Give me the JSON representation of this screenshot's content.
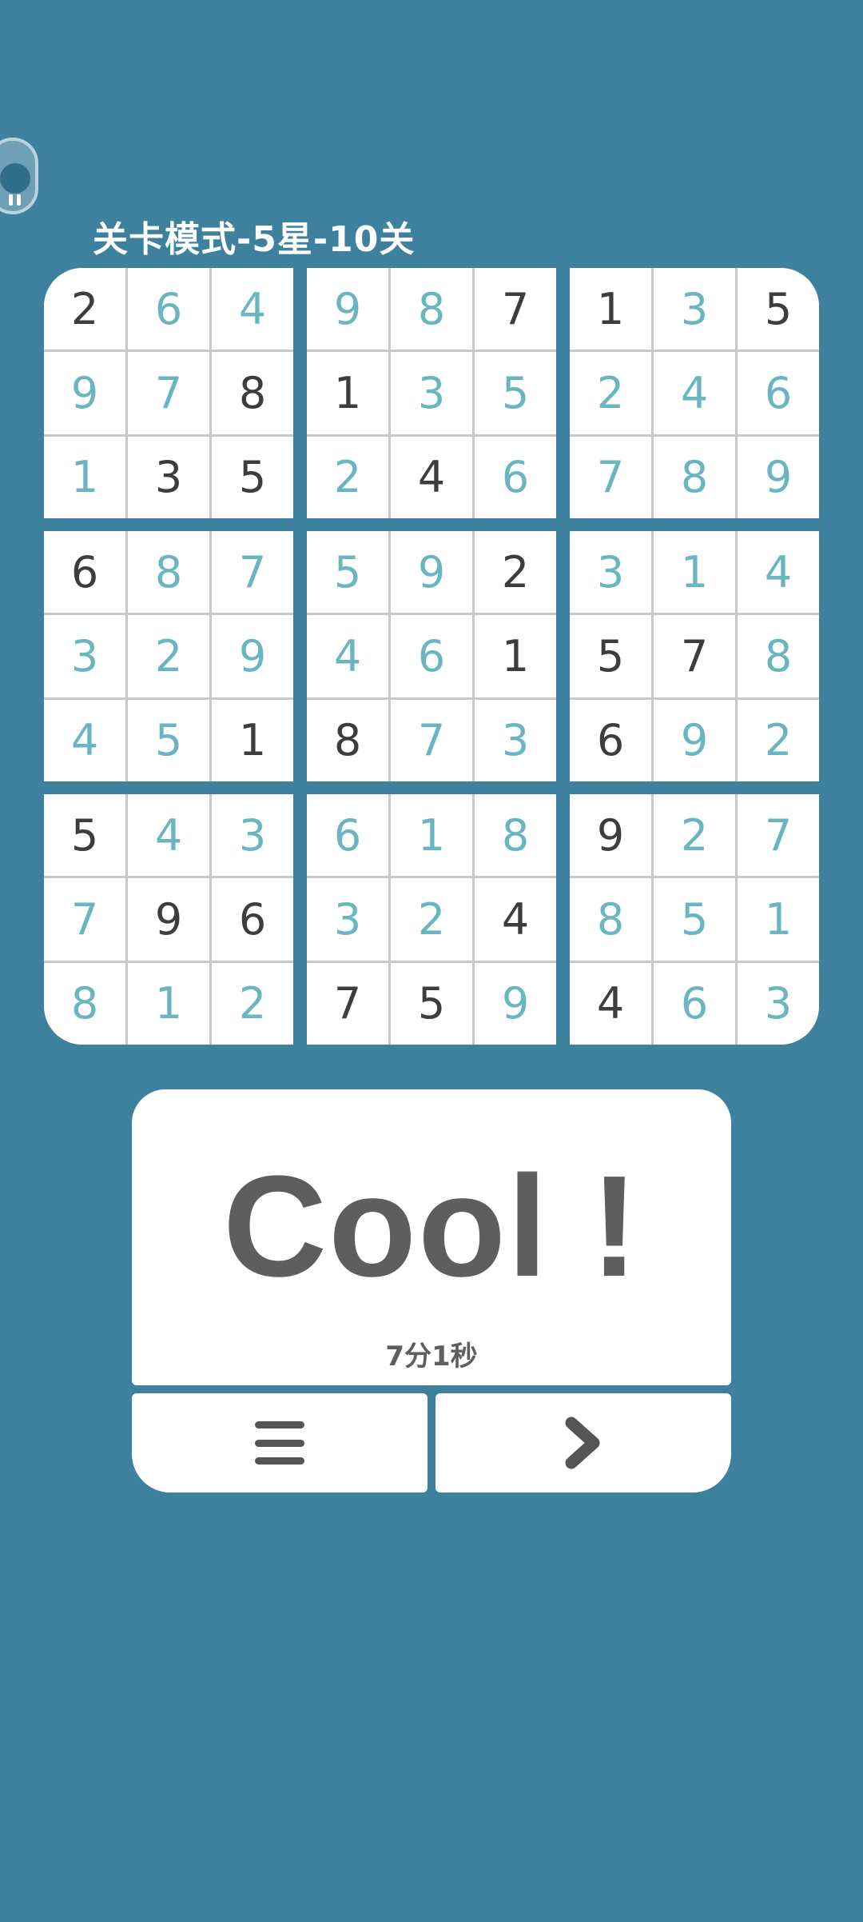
{
  "header": {
    "title": "关卡模式-5星-10关"
  },
  "board": {
    "rows": [
      [
        2,
        6,
        4,
        9,
        8,
        7,
        1,
        3,
        5
      ],
      [
        9,
        7,
        8,
        1,
        3,
        5,
        2,
        4,
        6
      ],
      [
        1,
        3,
        5,
        2,
        4,
        6,
        7,
        8,
        9
      ],
      [
        6,
        8,
        7,
        5,
        9,
        2,
        3,
        1,
        4
      ],
      [
        3,
        2,
        9,
        4,
        6,
        1,
        5,
        7,
        8
      ],
      [
        4,
        5,
        1,
        8,
        7,
        3,
        6,
        9,
        2
      ],
      [
        5,
        4,
        3,
        6,
        1,
        8,
        9,
        2,
        7
      ],
      [
        7,
        9,
        6,
        3,
        2,
        4,
        8,
        5,
        1
      ],
      [
        8,
        1,
        2,
        7,
        5,
        9,
        4,
        6,
        3
      ]
    ],
    "given": [
      [
        1,
        0,
        0,
        0,
        0,
        1,
        1,
        0,
        1
      ],
      [
        0,
        0,
        1,
        1,
        0,
        0,
        0,
        0,
        0
      ],
      [
        0,
        1,
        1,
        0,
        1,
        0,
        0,
        0,
        0
      ],
      [
        1,
        0,
        0,
        0,
        0,
        1,
        0,
        0,
        0
      ],
      [
        0,
        0,
        0,
        0,
        0,
        1,
        1,
        1,
        0
      ],
      [
        0,
        0,
        1,
        1,
        0,
        0,
        1,
        0,
        0
      ],
      [
        1,
        0,
        0,
        0,
        0,
        0,
        1,
        0,
        0
      ],
      [
        0,
        1,
        1,
        0,
        0,
        1,
        0,
        0,
        0
      ],
      [
        0,
        0,
        0,
        1,
        1,
        0,
        1,
        0,
        0
      ]
    ],
    "colors": {
      "given": "#3d3d3d",
      "filled": "#6ab6c0"
    }
  },
  "result": {
    "headline": "Cool !",
    "time": "7分1秒"
  },
  "buttons": {
    "menu_icon": "menu-icon",
    "next_icon": "chevron-right-icon"
  },
  "theme": {
    "background": "#3d819e",
    "card": "#ffffff"
  }
}
